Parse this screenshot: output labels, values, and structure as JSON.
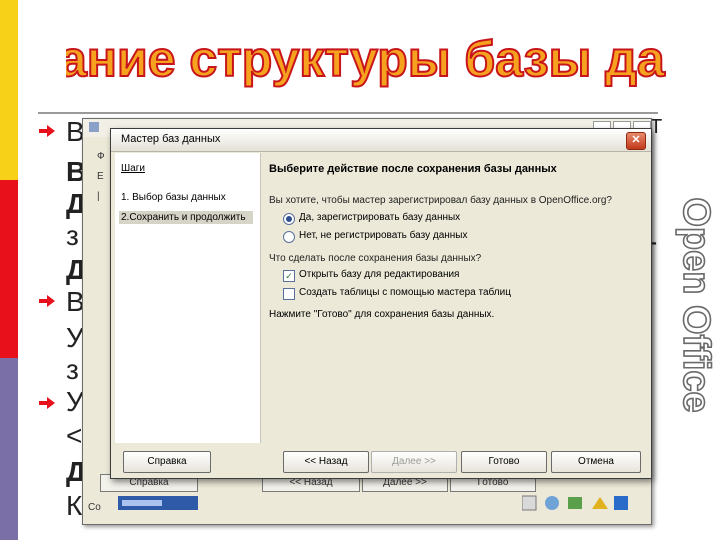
{
  "slide": {
    "title": "Создание структуры базы данных",
    "side_label": "Open Office",
    "text_fragments": [
      "В",
      "В",
      "Д",
      "з",
      "Д",
      "В",
      "У",
      "з",
      "У",
      "<",
      "Д",
      "К",
      "-",
      "Т"
    ]
  },
  "background_window": {
    "menu": [
      "Ф",
      "E",
      "|"
    ],
    "buttons": [
      "Справка",
      "<< Назад",
      "Далее >>",
      "Готово"
    ],
    "status": "Со"
  },
  "dialog": {
    "title": "Мастер баз данных",
    "close_glyph": "✕",
    "steps_header": "Шаги",
    "steps": [
      {
        "label": "1. Выбор базы данных",
        "active": false
      },
      {
        "label": "2.Сохранить и продолжить",
        "active": true
      }
    ],
    "heading": "Выберите действие после сохранения базы данных",
    "question1": "Вы хотите, чтобы мастер зарегистрировал базу данных в OpenOffice.org?",
    "radio_options": [
      {
        "label": "Да, зарегистрировать базу данных",
        "selected": true
      },
      {
        "label": "Нет, не регистрировать базу данных",
        "selected": false
      }
    ],
    "question2": "Что сделать после сохранения базы данных?",
    "check_options": [
      {
        "label": "Открыть базу для редактирования",
        "checked": true
      },
      {
        "label": "Создать таблицы с помощью мастера таблиц",
        "checked": false
      }
    ],
    "hint": "Нажмите \"Готово\" для сохранения базы данных.",
    "buttons": {
      "help": "Справка",
      "back": "<< Назад",
      "next": "Далее >>",
      "finish": "Готово",
      "cancel": "Отмена"
    }
  },
  "colors": {
    "strip_yellow": "#f7d117",
    "strip_red": "#e8101a",
    "strip_purple": "#7a6fa6",
    "title_orange": "#f6a21f",
    "title_outline": "#c8151b",
    "close_red": "#c1391a"
  }
}
